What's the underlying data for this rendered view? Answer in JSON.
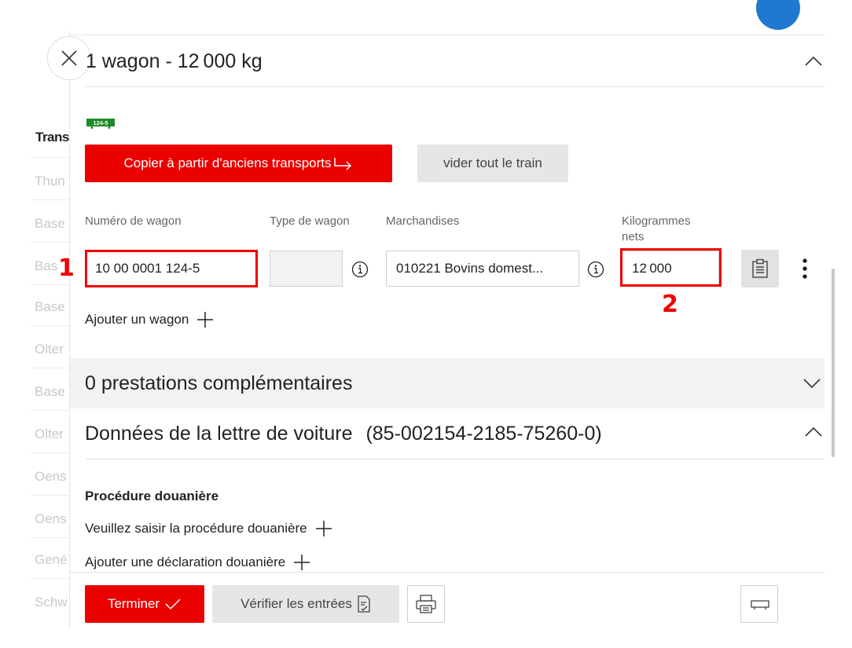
{
  "background_list": {
    "header": "Trans",
    "rows": [
      "Thun",
      "Base",
      "Bas",
      "Base",
      "Olter",
      "Base",
      "Olter",
      "Oens",
      "Oens",
      "Gené",
      "Schw"
    ]
  },
  "wagon_section": {
    "title": "1 wagon - 12 000 kg",
    "badge": "124-5",
    "copy_button": "Copier à partir d'anciens transports",
    "clear_button": "vider tout le train",
    "columns": {
      "wagon_number": "Numéro de wagon",
      "wagon_type": "Type de wagon",
      "goods": "Marchandises",
      "net_kg": "Kilogrammes nets"
    },
    "row": {
      "wagon_number": "10 00 0001 124-5",
      "wagon_type": "",
      "goods": "010221 Bovins domest...",
      "net_kg": "12 000"
    },
    "add_wagon": "Ajouter un wagon"
  },
  "services_section": {
    "title": "0 prestations complémentaires"
  },
  "waybill_section": {
    "title": "Données de la lettre de voiture",
    "number": "(85-002154-2185-75260-0)",
    "customs_heading": "Procédure douanière",
    "enter_customs": "Veuillez saisir la procédure douanière",
    "add_declaration": "Ajouter une déclaration douanière"
  },
  "footer": {
    "finish_button": "Terminer",
    "verify_button": "Vérifier les entrées"
  },
  "annotations": {
    "callout_1": "1",
    "callout_2": "2"
  },
  "colors": {
    "accent_red": "#eb0000",
    "highlight_red": "#ee0000",
    "badge_green": "#1e8a2a",
    "blue": "#1f78d1"
  }
}
